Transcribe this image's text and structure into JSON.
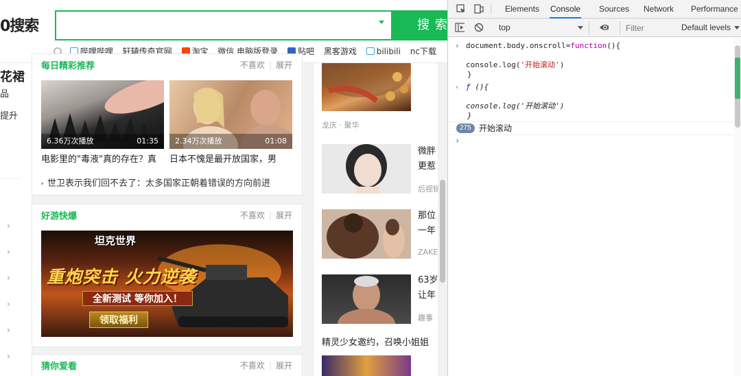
{
  "browser_page": {
    "logo_text": "0搜索",
    "search": {
      "value": "",
      "button_label": "搜索"
    },
    "quick_links": [
      {
        "label": "哔哩哔哩",
        "icon": "bilibili-tv-icon"
      },
      {
        "label": "轩辕传奇官网",
        "icon": ""
      },
      {
        "label": "淘宝",
        "icon": "taobao-icon"
      },
      {
        "label": "微信 电脑版登录",
        "icon": ""
      },
      {
        "label": "贴吧",
        "icon": "tieba-icon"
      },
      {
        "label": "黑客游戏",
        "icon": ""
      },
      {
        "label": "bilibili",
        "icon": "bilibili-tv-icon"
      },
      {
        "label": "nc下载",
        "icon": ""
      }
    ],
    "left_fragments": [
      "花裙",
      "品",
      "提升"
    ],
    "cards": {
      "daily": {
        "title": "每日精彩推荐",
        "dislike": "不喜欢",
        "expand": "展开",
        "videos": [
          {
            "views": "6.36万次播放",
            "duration": "01:35",
            "title": "电影里的\"毒液\"真的存在？真"
          },
          {
            "views": "2.34万次播放",
            "duration": "01:08",
            "title": "日本不愧是最开放国家，男"
          }
        ],
        "news": "世卫表示我们回不去了：太多国家正朝着错误的方向前进"
      },
      "games": {
        "title": "好游快爆",
        "dislike": "不喜欢",
        "expand": "展开",
        "banner_logo": "坦克世界",
        "banner_headline": "重炮突击 火力逆袭",
        "banner_sub": "全新测试 等你加入！",
        "banner_button": "领取福利"
      },
      "guess": {
        "title": "猜你爱看",
        "dislike": "不喜欢",
        "expand": "展开"
      }
    },
    "right_items": [
      {
        "lines": [],
        "source": "龙庆 · 聚华"
      },
      {
        "lines": [
          "微胖",
          "更惹"
        ],
        "source": "后视镜"
      },
      {
        "lines": [
          "那位",
          "一年"
        ],
        "source": "ZAKER"
      },
      {
        "lines": [
          "63岁",
          "让年"
        ],
        "source": "趣事"
      }
    ],
    "right_caption": "精灵少女邀约，召唤小姐姐"
  },
  "devtools": {
    "tabs": [
      "Elements",
      "Console",
      "Sources",
      "Network",
      "Performance"
    ],
    "active_tab": "Console",
    "context": "top",
    "filter_placeholder": "Filter",
    "levels_label": "Default levels",
    "console": {
      "input_line1": "document.body.onscroll=",
      "input_kw": "function",
      "input_line1_end": "(){",
      "input_log_call": "console.log(",
      "input_log_str": "'开始滚动'",
      "input_log_end": ")",
      "input_close": "}",
      "result_f": "ƒ ",
      "result_sig": "(){",
      "result_log": "console.log('开始滚动')",
      "result_close": "}",
      "repeat_count": "275",
      "log_output": "开始滚动"
    }
  }
}
